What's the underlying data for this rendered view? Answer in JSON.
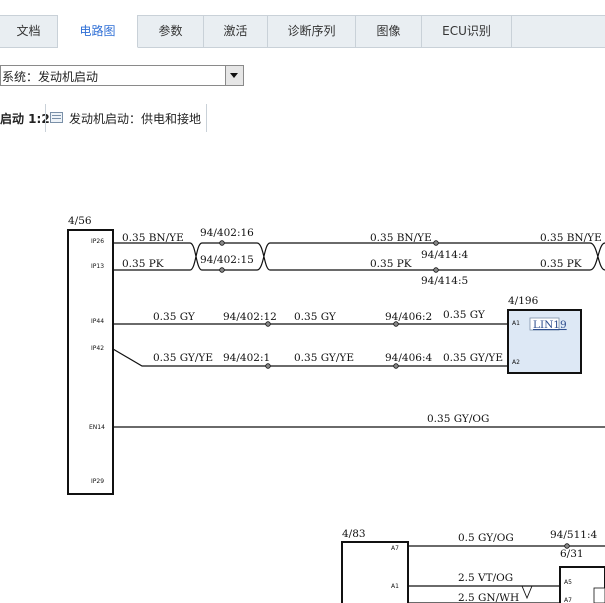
{
  "tabs": [
    {
      "label": "文档",
      "active": false
    },
    {
      "label": "电路图",
      "active": true
    },
    {
      "label": "参数",
      "active": false
    },
    {
      "label": "激活",
      "active": false
    },
    {
      "label": "诊断序列",
      "active": false
    },
    {
      "label": "图像",
      "active": false
    },
    {
      "label": "ECU识别",
      "active": false
    }
  ],
  "system_select": {
    "value": "系统：发动机启动"
  },
  "breadcrumb": {
    "page_label": "启动 1:2",
    "title": "发动机启动：供电和接地"
  },
  "colors": {
    "accent": "#2f6fd6",
    "tab_bg": "#e9eef2",
    "component_fill": "#dde8f5"
  },
  "diagram": {
    "comp_left": {
      "ref": "4/56",
      "pins": [
        "IP26",
        "IP13",
        "IP44",
        "IP42",
        "EN14",
        "IP29"
      ]
    },
    "comp_right": {
      "ref": "4/196",
      "pins": [
        "A1",
        "A2"
      ],
      "link": "LIN19"
    },
    "comp_bottom": {
      "ref": "4/83",
      "pins": [
        "A7",
        "A1"
      ],
      "pins2": [
        "A5",
        "A7"
      ]
    },
    "wires": {
      "w1a": "0.35 BN/YE",
      "w1b": "0.35 BN/YE",
      "w1c": "0.35 BN/YE",
      "w2a": "0.35 PK",
      "w2b": "0.35 PK",
      "w2c": "0.35 PK",
      "w3a": "0.35 GY",
      "w3b": "0.35 GY",
      "w3c": "0.35 GY",
      "w4a": "0.35 GY/YE",
      "w4b": "0.35 GY/YE",
      "w4c": "0.35 GY/YE",
      "w5": "0.35 GY/OG",
      "w6": "0.5 GY/OG",
      "w7": "2.5 VT/OG",
      "w8": "2.5 GN/WH"
    },
    "connectors": {
      "c1": "94/402:16",
      "c2": "94/402:15",
      "c3": "94/414:4",
      "c4": "94/414:5",
      "c5": "94/402:12",
      "c6": "94/406:2",
      "c7": "94/402:1",
      "c8": "94/406:4",
      "c9": "94/511:4",
      "c10": "6/31"
    }
  }
}
